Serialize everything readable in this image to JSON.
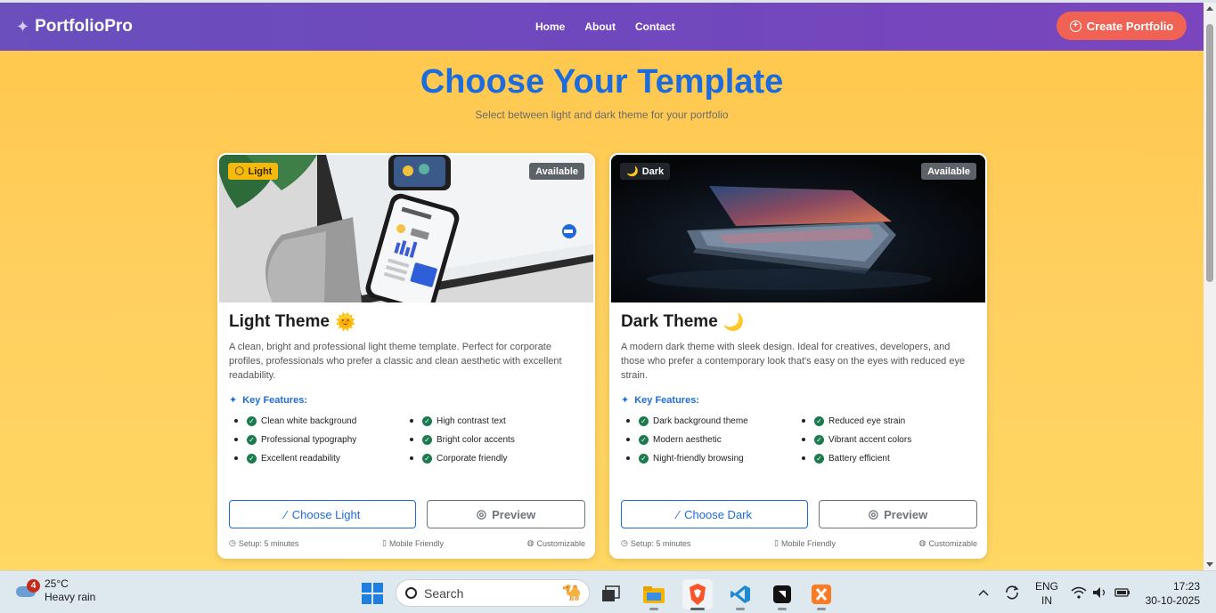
{
  "navbar": {
    "brand": "PortfolioPro",
    "links": [
      "Home",
      "About",
      "Contact"
    ],
    "cta": "Create Portfolio"
  },
  "hero": {
    "title": "Choose Your Template",
    "subtitle": "Select between light and dark theme for your portfolio"
  },
  "cards": [
    {
      "badge": "Light",
      "badge_emoji": "🌕",
      "status": "Available",
      "title": "Light Theme",
      "title_emoji": "🌞",
      "description": "A clean, bright and professional light theme template. Perfect for corporate profiles, professionals who prefer a classic and clean aesthetic with excellent readability.",
      "features_heading": "Key Features:",
      "features": [
        "Clean white background",
        "High contrast text",
        "Professional typography",
        "Bright color accents",
        "Excellent readability",
        "Corporate friendly"
      ],
      "choose_label": "Choose Light",
      "preview_label": "Preview",
      "meta": [
        "Setup: 5 minutes",
        "Mobile Friendly",
        "Customizable"
      ]
    },
    {
      "badge": "Dark",
      "badge_emoji": "🌙",
      "status": "Available",
      "title": "Dark Theme",
      "title_emoji": "🌙",
      "description": "A modern dark theme with sleek design. Ideal for creatives, developers, and those who prefer a contemporary look that's easy on the eyes with reduced eye strain.",
      "features_heading": "Key Features:",
      "features": [
        "Dark background theme",
        "Reduced eye strain",
        "Modern aesthetic",
        "Vibrant accent colors",
        "Night-friendly browsing",
        "Battery efficient"
      ],
      "choose_label": "Choose Dark",
      "preview_label": "Preview",
      "meta": [
        "Setup: 5 minutes",
        "Mobile Friendly",
        "Customizable"
      ]
    }
  ],
  "taskbar": {
    "weather_badge": "4",
    "temperature": "25°C",
    "condition": "Heavy rain",
    "search_placeholder": "Search",
    "lang_top": "ENG",
    "lang_bottom": "IN",
    "time": "17:23",
    "date": "30-10-2025"
  },
  "colors": {
    "nav": "#7048bd",
    "accent": "#1d6cde",
    "cta": "#f06354",
    "background": "#ffd060",
    "check": "#1c7a4f"
  },
  "icons": {
    "brand": "sparkle-icon",
    "cta": "plus-circle-icon",
    "choose": "magic-wand-icon",
    "preview": "eye-icon",
    "features": "sparkle-icon",
    "check": "check-circle-icon",
    "setup": "clock-icon",
    "mobile": "phone-icon",
    "custom": "palette-icon"
  }
}
